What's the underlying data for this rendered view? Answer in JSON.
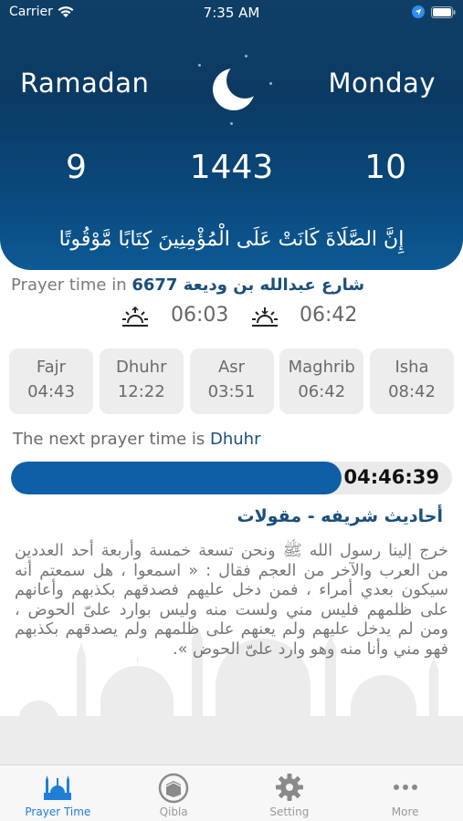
{
  "status_bar": {
    "carrier": "Carrier",
    "time": "7:35 AM"
  },
  "header": {
    "month": "Ramadan",
    "weekday": "Monday",
    "day": "9",
    "year": "1443",
    "date_number": "10",
    "verse": "إِنَّ الصَّلَاةَ كَانَتْ عَلَى الْمُؤْمِنِينَ كِتَابًا مَّوْقُوتًا"
  },
  "location": {
    "prefix": "Prayer time in ",
    "place": "6677 شارع عبدالله بن وديعة"
  },
  "sun": {
    "sunrise_time": "06:03",
    "sunset_time": "06:42"
  },
  "prayers": [
    {
      "name": "Fajr",
      "time": "04:43"
    },
    {
      "name": "Dhuhr",
      "time": "12:22"
    },
    {
      "name": "Asr",
      "time": "03:51"
    },
    {
      "name": "Maghrib",
      "time": "06:42"
    },
    {
      "name": "Isha",
      "time": "08:42"
    }
  ],
  "next_prayer": {
    "prefix": "The next prayer time is ",
    "name": "Dhuhr",
    "countdown": "04:46:39",
    "progress_fraction": 0.75
  },
  "hadith": {
    "title": "أحاديث شريفه - مقولات",
    "body": "خرج إلينا رسول الله ﷺ ونحن تسعة خمسة وأربعة أحد العددين من العرب والآخر من العجم فقال : « اسمعوا ، هل سمعتم أنه سيكون بعدي أمراء ، فمن دخل عليهم فصدقهم بكذبهم وأعانهم على ظلمهم فليس مني ولست منه وليس بوارد علىّ الحوض ، ومن لم يدخل عليهم ولم يعنهم على ظلمهم ولم يصدقهم بكذبهم فهو مني وأنا منه وهو وارد علىّ الحوض »."
  },
  "tabs": [
    {
      "label": "Prayer Time",
      "icon": "mosque-icon",
      "active": true
    },
    {
      "label": "Qibla",
      "icon": "kaaba-icon",
      "active": false
    },
    {
      "label": "Setting",
      "icon": "gear-icon",
      "active": false
    },
    {
      "label": "More",
      "icon": "more-icon",
      "active": false
    }
  ],
  "colors": {
    "header": "#0b3a63",
    "accent": "#0e5fa6",
    "active_tab": "#1f7fd6",
    "label_blue": "#1a4f7c"
  }
}
